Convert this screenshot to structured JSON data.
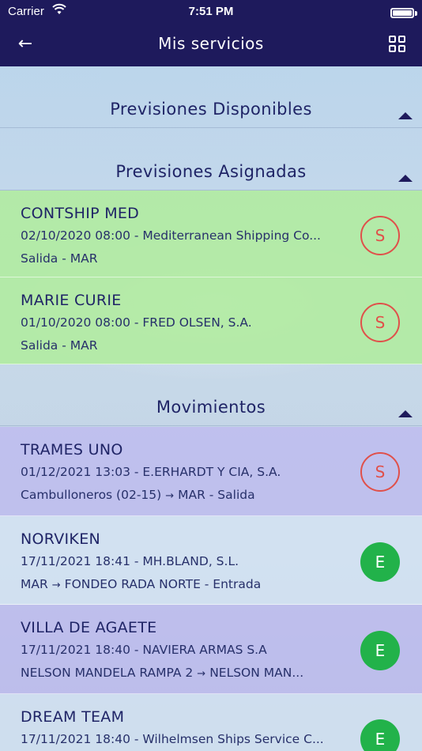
{
  "status_bar": {
    "carrier": "Carrier",
    "wifi_icon": "wifi-icon",
    "time": "7:51 PM",
    "battery_icon": "battery-icon"
  },
  "navbar": {
    "title": "Mis servicios",
    "back_icon": "arrow-left-icon",
    "grid_icon": "grid-icon",
    "back_glyph": "←"
  },
  "sections": [
    {
      "title": "Previsiones Disponibles"
    },
    {
      "title": "Previsiones Asignadas"
    },
    {
      "title": "Movimientos"
    }
  ],
  "assigned": [
    {
      "name": "CONTSHIP MED",
      "detail": "02/10/2020 08:00 - Mediterranean Shipping Co...",
      "info": "Salida - MAR",
      "badge": "S"
    },
    {
      "name": "MARIE CURIE",
      "detail": "01/10/2020 08:00 - FRED OLSEN, S.A.",
      "info": "Salida - MAR",
      "badge": "S"
    }
  ],
  "movements": [
    {
      "name": "TRAMES UNO",
      "detail": "01/12/2021 13:03 - E.ERHARDT Y CIA, S.A.",
      "from": "Cambulloneros (02-15)",
      "to": "MAR - Salida",
      "badge": "S"
    },
    {
      "name": "NORVIKEN",
      "detail": "17/11/2021 18:41 - MH.BLAND, S.L.",
      "from": "MAR",
      "to": "FONDEO RADA NORTE - Entrada",
      "badge": "E"
    },
    {
      "name": "VILLA DE AGAETE",
      "detail": "17/11/2021 18:40 - NAVIERA ARMAS S.A",
      "from": "NELSON MANDELA RAMPA 2",
      "to": "NELSON MAN...",
      "badge": "E"
    },
    {
      "name": "DREAM TEAM",
      "detail": "17/11/2021 18:40 - Wilhelmsen Ships Service C...",
      "from": "",
      "to": "",
      "badge": "E"
    }
  ],
  "glyphs": {
    "route_arrow": "→"
  },
  "colors": {
    "navbar": "#1e1a5c",
    "title_text": "#1f2466",
    "badge_s": "#e0504a",
    "badge_e": "#22b24a",
    "assigned_row": "#b0ec9e",
    "movement_row": "#bebcee"
  }
}
